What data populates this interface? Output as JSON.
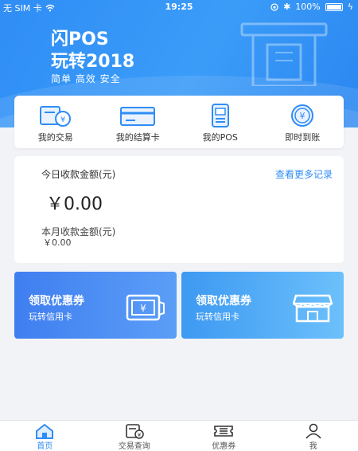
{
  "status_bar": {
    "carrier": "无 SIM 卡",
    "time": "19:25",
    "battery_percent": "100%"
  },
  "promo": {
    "title_line1": "闪POS",
    "title_line2": "玩转2018",
    "subtitle": "简单 高效 安全"
  },
  "quick_actions": [
    {
      "label": "我的交易",
      "icon": "wallet-yuan-icon"
    },
    {
      "label": "我的结算卡",
      "icon": "bank-card-icon"
    },
    {
      "label": "我的POS",
      "icon": "pos-terminal-icon"
    },
    {
      "label": "即时到账",
      "icon": "yuan-coin-icon"
    }
  ],
  "earnings": {
    "today_label": "今日收款金额(元)",
    "more_link": "查看更多记录",
    "today_amount": "￥0.00",
    "month_label": "本月收款金额(元)",
    "month_amount": "￥0.00"
  },
  "coupons": [
    {
      "title": "领取优惠券",
      "subtitle": "玩转信用卡",
      "icon": "ticket-yuan-icon"
    },
    {
      "title": "领取优惠券",
      "subtitle": "玩转信用卡",
      "icon": "storefront-icon"
    }
  ],
  "tabbar": [
    {
      "label": "首页",
      "icon": "home-icon",
      "active": true
    },
    {
      "label": "交易查询",
      "icon": "transaction-query-icon",
      "active": false
    },
    {
      "label": "优惠券",
      "icon": "coupon-icon",
      "active": false
    },
    {
      "label": "我",
      "icon": "user-icon",
      "active": false
    }
  ],
  "colors": {
    "primary": "#2f8df5",
    "background": "#f2f3f7"
  }
}
